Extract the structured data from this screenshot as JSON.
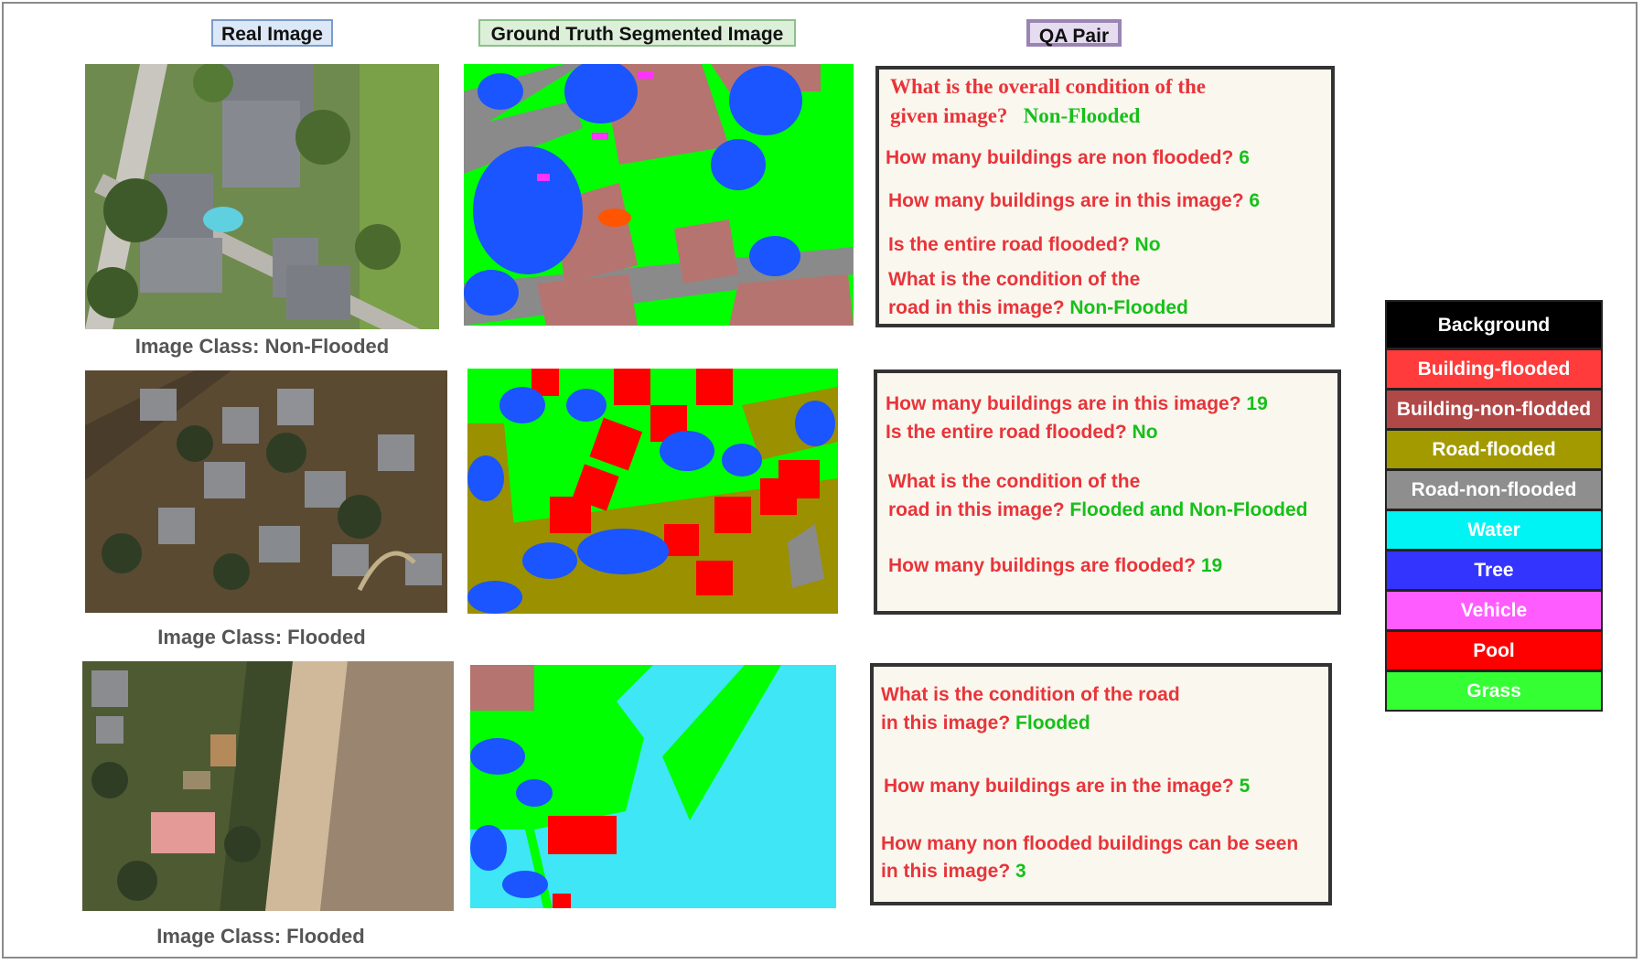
{
  "headers": {
    "real": "Real Image",
    "gt": "Ground Truth Segmented Image",
    "qa": "QA Pair"
  },
  "captions": [
    "Image Class: Non-Flooded",
    "Image Class: Flooded",
    "Image Class: Flooded"
  ],
  "rows": [
    {
      "qa": [
        {
          "q": "What is the overall condition of the",
          "a": ""
        },
        {
          "q": "given image?",
          "a": "Non-Flooded"
        },
        {
          "q": "How many buildings are non flooded?",
          "a": "6"
        },
        {
          "q": "How many buildings are in this image?",
          "a": "6"
        },
        {
          "q": "Is the entire road flooded?",
          "a": "No"
        },
        {
          "q": "What is the condition of the",
          "a": ""
        },
        {
          "q": "road in this image?",
          "a": "Non-Flooded"
        }
      ]
    },
    {
      "qa": [
        {
          "q": "How many buildings are in this image?",
          "a": "19"
        },
        {
          "q": "Is the entire road flooded?",
          "a": "No"
        },
        {
          "q": "What is the condition of the",
          "a": ""
        },
        {
          "q": "road in this image?",
          "a": "Flooded and Non-Flooded"
        },
        {
          "q": "How many buildings are flooded?",
          "a": "19"
        }
      ]
    },
    {
      "qa": [
        {
          "q": "What is the condition of the road",
          "a": ""
        },
        {
          "q": "in this image?",
          "a": "Flooded"
        },
        {
          "q": "How many buildings are in the image?",
          "a": "5"
        },
        {
          "q": "How many non flooded buildings can be seen",
          "a": ""
        },
        {
          "q": "in this image?",
          "a": "3"
        }
      ]
    }
  ],
  "legend": [
    {
      "label": "Background",
      "color": "#000000"
    },
    {
      "label": "Building-flooded",
      "color": "#ff3b3b"
    },
    {
      "label": "Building-non-flodded",
      "color": "#b04848"
    },
    {
      "label": "Road-flooded",
      "color": "#a39a00"
    },
    {
      "label": "Road-non-flooded",
      "color": "#8e8e8e"
    },
    {
      "label": "Water",
      "color": "#00f4f4"
    },
    {
      "label": "Tree",
      "color": "#3434ff"
    },
    {
      "label": "Vehicle",
      "color": "#ff5cff"
    },
    {
      "label": "Pool",
      "color": "#ff0000"
    },
    {
      "label": "Grass",
      "color": "#33ff33"
    }
  ]
}
